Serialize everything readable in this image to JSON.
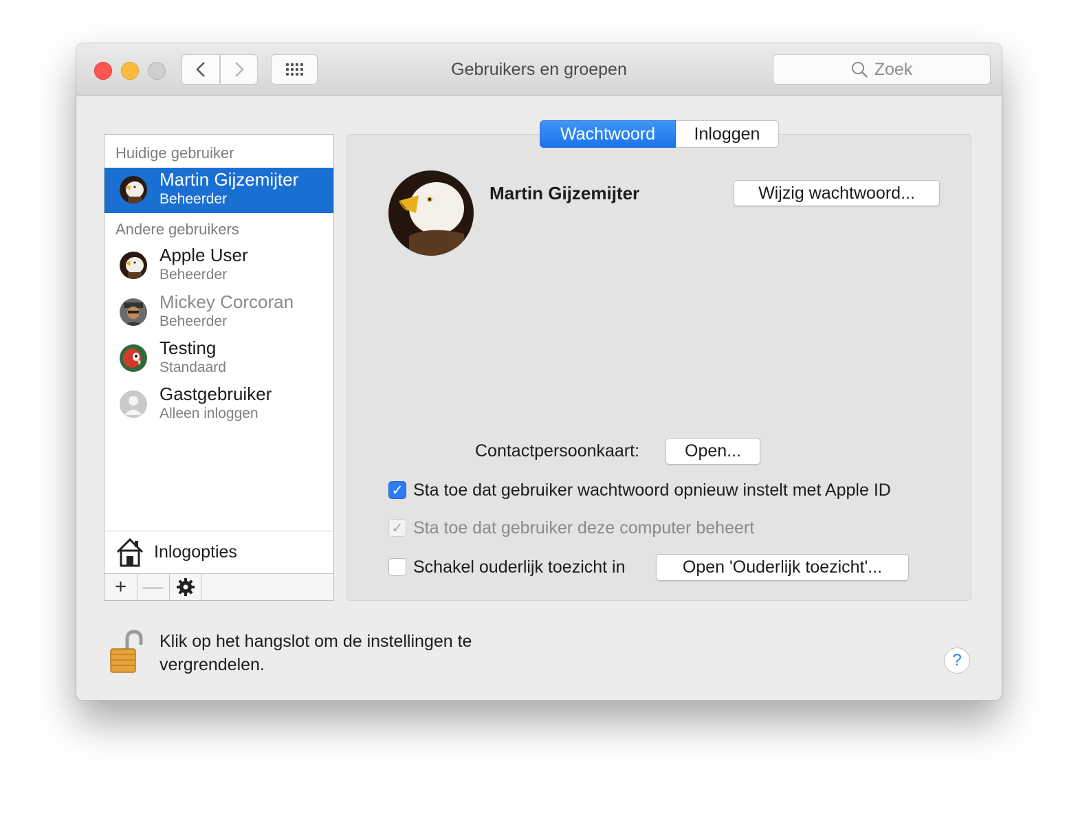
{
  "window": {
    "title": "Gebruikers en groepen"
  },
  "toolbar": {
    "back_icon": "chevron-left-icon",
    "forward_icon": "chevron-right-icon",
    "grid_icon": "grid-icon",
    "search_placeholder": "Zoek"
  },
  "sidebar": {
    "current_header": "Huidige gebruiker",
    "others_header": "Andere gebruikers",
    "current_user": {
      "name": "Martin Gijzemijter",
      "role": "Beheerder",
      "avatar": "eagle-avatar"
    },
    "other_users": [
      {
        "name": "Apple User",
        "role": "Beheerder",
        "avatar": "eagle-avatar"
      },
      {
        "name": "Mickey Corcoran",
        "role": "Beheerder",
        "avatar": "person-avatar"
      },
      {
        "name": "Testing",
        "role": "Standaard",
        "avatar": "parrot-avatar"
      },
      {
        "name": "Gastgebruiker",
        "role": "Alleen inloggen",
        "avatar": "guest-avatar"
      }
    ],
    "login_options": "Inlogopties",
    "tools": {
      "add": "+",
      "remove": "—",
      "settings_icon": "gear-icon"
    }
  },
  "tabs": [
    {
      "label": "Wachtwoord",
      "active": true
    },
    {
      "label": "Inloggen",
      "active": false
    }
  ],
  "main": {
    "user_name": "Martin Gijzemijter",
    "change_password_button": "Wijzig wachtwoord...",
    "contact_label": "Contactpersoonkaart:",
    "contact_open_button": "Open...",
    "checkbox_reset_apple_id": {
      "label": "Sta toe dat gebruiker wachtwoord opnieuw instelt met Apple ID",
      "checked": true
    },
    "checkbox_admin": {
      "label": "Sta toe dat gebruiker deze computer beheert",
      "checked": true,
      "disabled": true
    },
    "checkbox_parental": {
      "label": "Schakel ouderlijk toezicht in",
      "checked": false
    },
    "parental_open_button": "Open 'Ouderlijk toezicht'..."
  },
  "footer": {
    "lock_text": "Klik op het hangslot om de instellingen te vergrendelen.",
    "help_label": "?"
  },
  "colors": {
    "accent": "#1a6fd3",
    "close": "#fc5753",
    "minimize": "#fdbc40"
  }
}
